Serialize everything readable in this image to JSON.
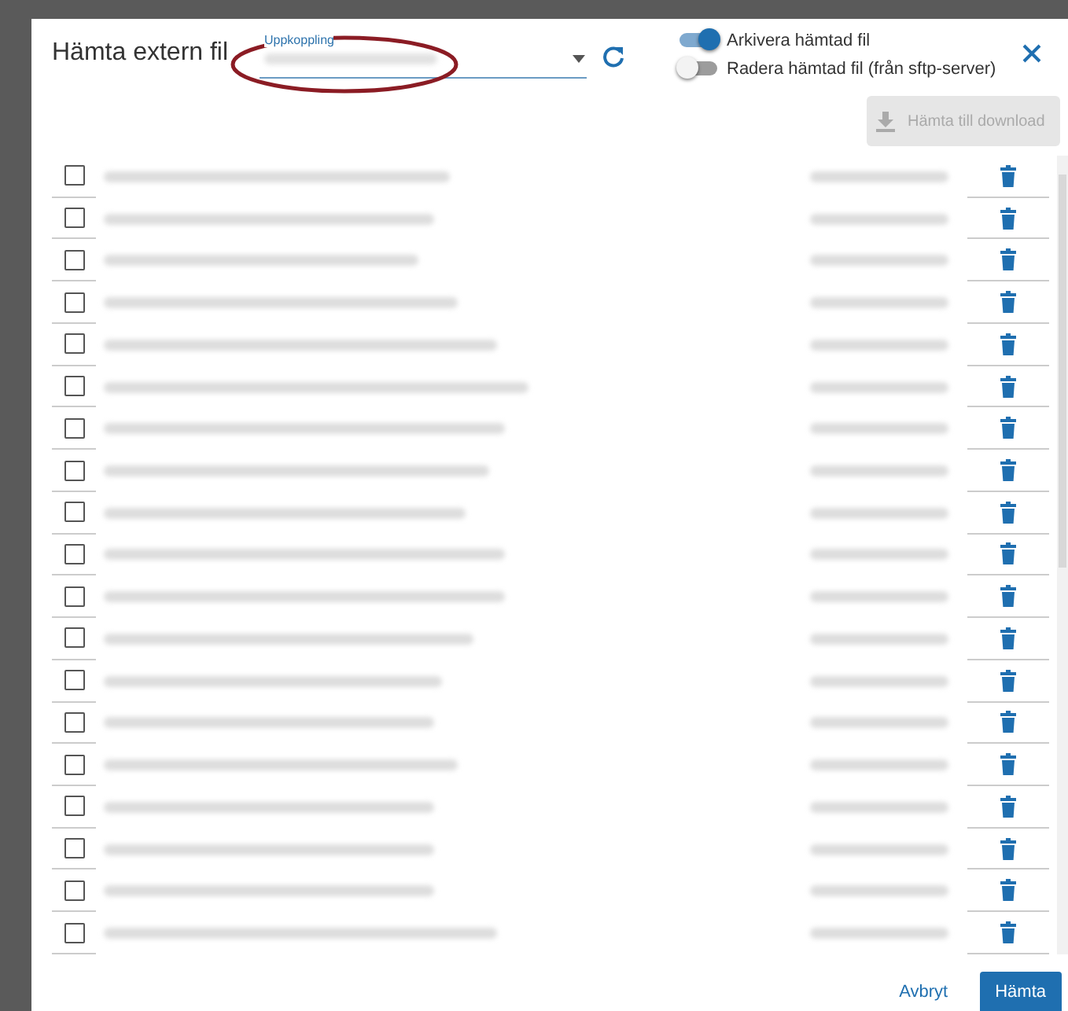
{
  "dialog": {
    "title": "Hämta extern fil",
    "connection": {
      "label": "Uppkoppling",
      "value_redacted": true
    },
    "toggles": [
      {
        "label": "Arkivera hämtad fil",
        "on": true
      },
      {
        "label": "Radera hämtad fil (från sftp-server)",
        "on": false
      }
    ],
    "download_button": {
      "label": "Hämta till download",
      "disabled": true
    },
    "files": [
      {
        "checked": false,
        "kind": "redacted"
      },
      {
        "checked": false,
        "kind": "redacted"
      },
      {
        "checked": false,
        "kind": "redacted"
      },
      {
        "checked": false,
        "kind": "redacted"
      },
      {
        "checked": false,
        "kind": "redacted"
      },
      {
        "checked": false,
        "kind": "redacted"
      },
      {
        "checked": false,
        "kind": "redacted"
      },
      {
        "checked": false,
        "kind": "redacted"
      },
      {
        "checked": false,
        "kind": "redacted"
      },
      {
        "checked": false,
        "kind": "redacted"
      },
      {
        "checked": false,
        "kind": "redacted"
      },
      {
        "checked": false,
        "kind": "redacted"
      },
      {
        "checked": false,
        "kind": "redacted"
      },
      {
        "checked": false,
        "kind": "redacted"
      },
      {
        "checked": false,
        "kind": "redacted"
      },
      {
        "checked": false,
        "kind": "redacted"
      },
      {
        "checked": false,
        "kind": "redacted"
      },
      {
        "checked": false,
        "kind": "redacted"
      },
      {
        "checked": false,
        "kind": "redacted"
      }
    ],
    "buttons": [
      {
        "label": "Avbryt",
        "kind": "text"
      },
      {
        "label": "Hämta",
        "kind": "primary"
      }
    ]
  }
}
